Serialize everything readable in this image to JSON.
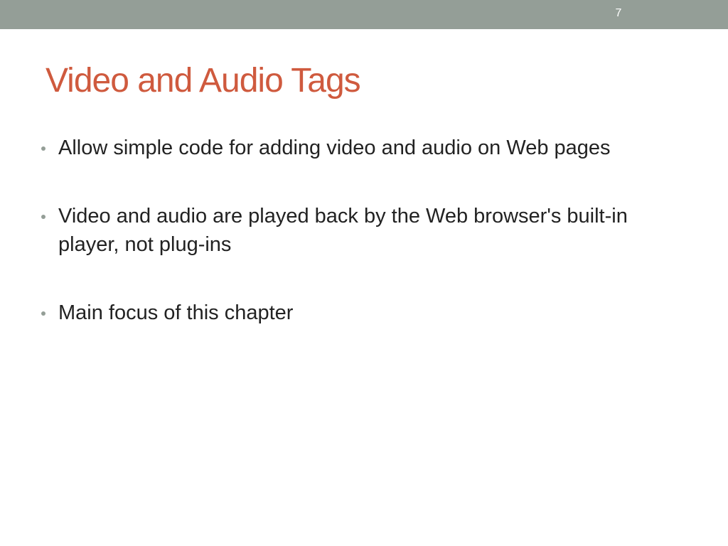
{
  "slide": {
    "number": "7",
    "title": "Video and Audio Tags",
    "bullets": [
      "Allow simple code for adding video and audio on Web pages",
      "Video and audio are played back by the Web browser's built-in player, not plug-ins",
      "Main focus of this chapter"
    ]
  },
  "colors": {
    "top_bar": "#949e97",
    "title": "#cf5a3e",
    "body_text": "#222222",
    "bullet": "#949e97"
  }
}
